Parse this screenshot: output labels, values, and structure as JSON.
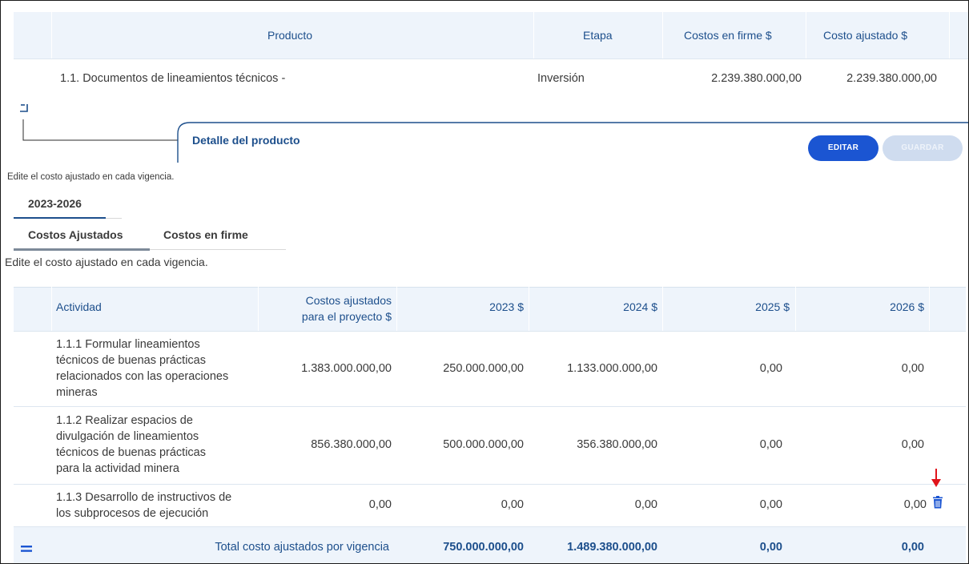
{
  "product_table": {
    "headers": [
      "Producto",
      "Etapa",
      "Costos en firme $",
      "Costo ajustado $"
    ],
    "row": {
      "producto": "1.1. Documentos de lineamientos técnicos -",
      "etapa": "Inversión",
      "costos_firme": "2.239.380.000,00",
      "costo_ajustado": "2.239.380.000,00"
    }
  },
  "detail": {
    "title": "Detalle del producto",
    "edit_label": "EDITAR",
    "save_label": "GUARDAR",
    "note": "Edite el costo ajustado en cada vigencia.",
    "period_tab": "2023-2026",
    "tabs": [
      "Costos Ajustados",
      "Costos en firme"
    ],
    "note2": "Edite el costo ajustado en cada vigencia."
  },
  "activity_table": {
    "headers": {
      "actividad": "Actividad",
      "costos_line1": "Costos ajustados",
      "costos_line2": "para el proyecto $",
      "y2023": "2023 $",
      "y2024": "2024 $",
      "y2025": "2025 $",
      "y2026": "2026 $"
    },
    "rows": [
      {
        "lines": [
          "1.1.1 Formular lineamientos",
          "técnicos de buenas prácticas",
          "relacionados con las operaciones",
          "mineras"
        ],
        "total": "1.383.000.000,00",
        "y2023": "250.000.000,00",
        "y2024": "1.133.000.000,00",
        "y2025": "0,00",
        "y2026": "0,00"
      },
      {
        "lines": [
          "1.1.2 Realizar espacios de",
          "divulgación de lineamientos",
          "técnicos de buenas prácticas",
          "para la actividad minera"
        ],
        "total": "856.380.000,00",
        "y2023": "500.000.000,00",
        "y2024": "356.380.000,00",
        "y2025": "0,00",
        "y2026": "0,00"
      },
      {
        "lines": [
          "1.1.3 Desarrollo de instructivos de",
          "los subprocesos de ejecución"
        ],
        "total": "0,00",
        "y2023": "0,00",
        "y2024": "0,00",
        "y2025": "0,00",
        "y2026": "0,00"
      }
    ],
    "total": {
      "label": "Total costo ajustados por vigencia",
      "y2023": "750.000.000,00",
      "y2024": "1.489.380.000,00",
      "y2025": "0,00",
      "y2026": "0,00"
    }
  },
  "colors": {
    "primary": "#1b55d2",
    "header_bg": "#eef4fb",
    "heading_text": "#1d4f8c",
    "annotation_arrow": "#e0141b"
  },
  "icons": [
    "collapse-icon",
    "expand-total-icon",
    "trash-icon",
    "red-arrow-annotation"
  ]
}
